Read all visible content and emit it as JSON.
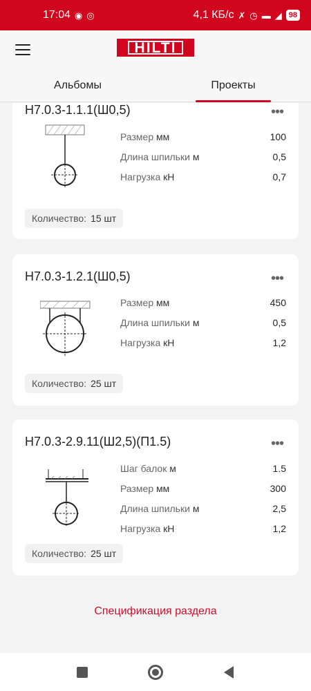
{
  "status_bar": {
    "time": "17:04",
    "network_speed": "4,1 КБ/с",
    "battery": "98",
    "icons": [
      "message-icon",
      "chrome-icon",
      "mute-icon",
      "alarm-icon",
      "signal-icon",
      "wifi-icon",
      "battery-icon"
    ]
  },
  "header": {
    "menu_icon": "hamburger-menu-icon",
    "logo": "HILTI",
    "tabs": [
      {
        "label": "Альбомы",
        "active": false
      },
      {
        "label": "Проекты",
        "active": true
      }
    ]
  },
  "cards": [
    {
      "title": "Н7.0.3-1.1.1(Ш0,5)",
      "props": [
        {
          "label": "Размер",
          "unit": "мм",
          "value": "100"
        },
        {
          "label": "Длина шпильки",
          "unit": "м",
          "value": "0,5"
        },
        {
          "label": "Нагрузка",
          "unit": "кН",
          "value": "0,7"
        }
      ],
      "quantity_label": "Количество:",
      "quantity_value": "15 шт"
    },
    {
      "title": "Н7.0.3-1.2.1(Ш0,5)",
      "props": [
        {
          "label": "Размер",
          "unit": "мм",
          "value": "450"
        },
        {
          "label": "Длина шпильки",
          "unit": "м",
          "value": "0,5"
        },
        {
          "label": "Нагрузка",
          "unit": "кН",
          "value": "1,2"
        }
      ],
      "quantity_label": "Количество:",
      "quantity_value": "25 шт"
    },
    {
      "title": "Н7.0.3-2.9.11(Ш2,5)(П1.5)",
      "props": [
        {
          "label": "Шаг балок",
          "unit": "м",
          "value": "1.5"
        },
        {
          "label": "Размер",
          "unit": "мм",
          "value": "300"
        },
        {
          "label": "Длина шпильки",
          "unit": "м",
          "value": "2,5"
        },
        {
          "label": "Нагрузка",
          "unit": "кН",
          "value": "1,2"
        }
      ],
      "quantity_label": "Количество:",
      "quantity_value": "25 шт"
    }
  ],
  "footer_link": "Спецификация раздела",
  "nav": {
    "icons": [
      "recents-square-icon",
      "home-circle-icon",
      "back-triangle-icon"
    ]
  },
  "colors": {
    "brand": "#d2051e",
    "link": "#c8102e"
  }
}
